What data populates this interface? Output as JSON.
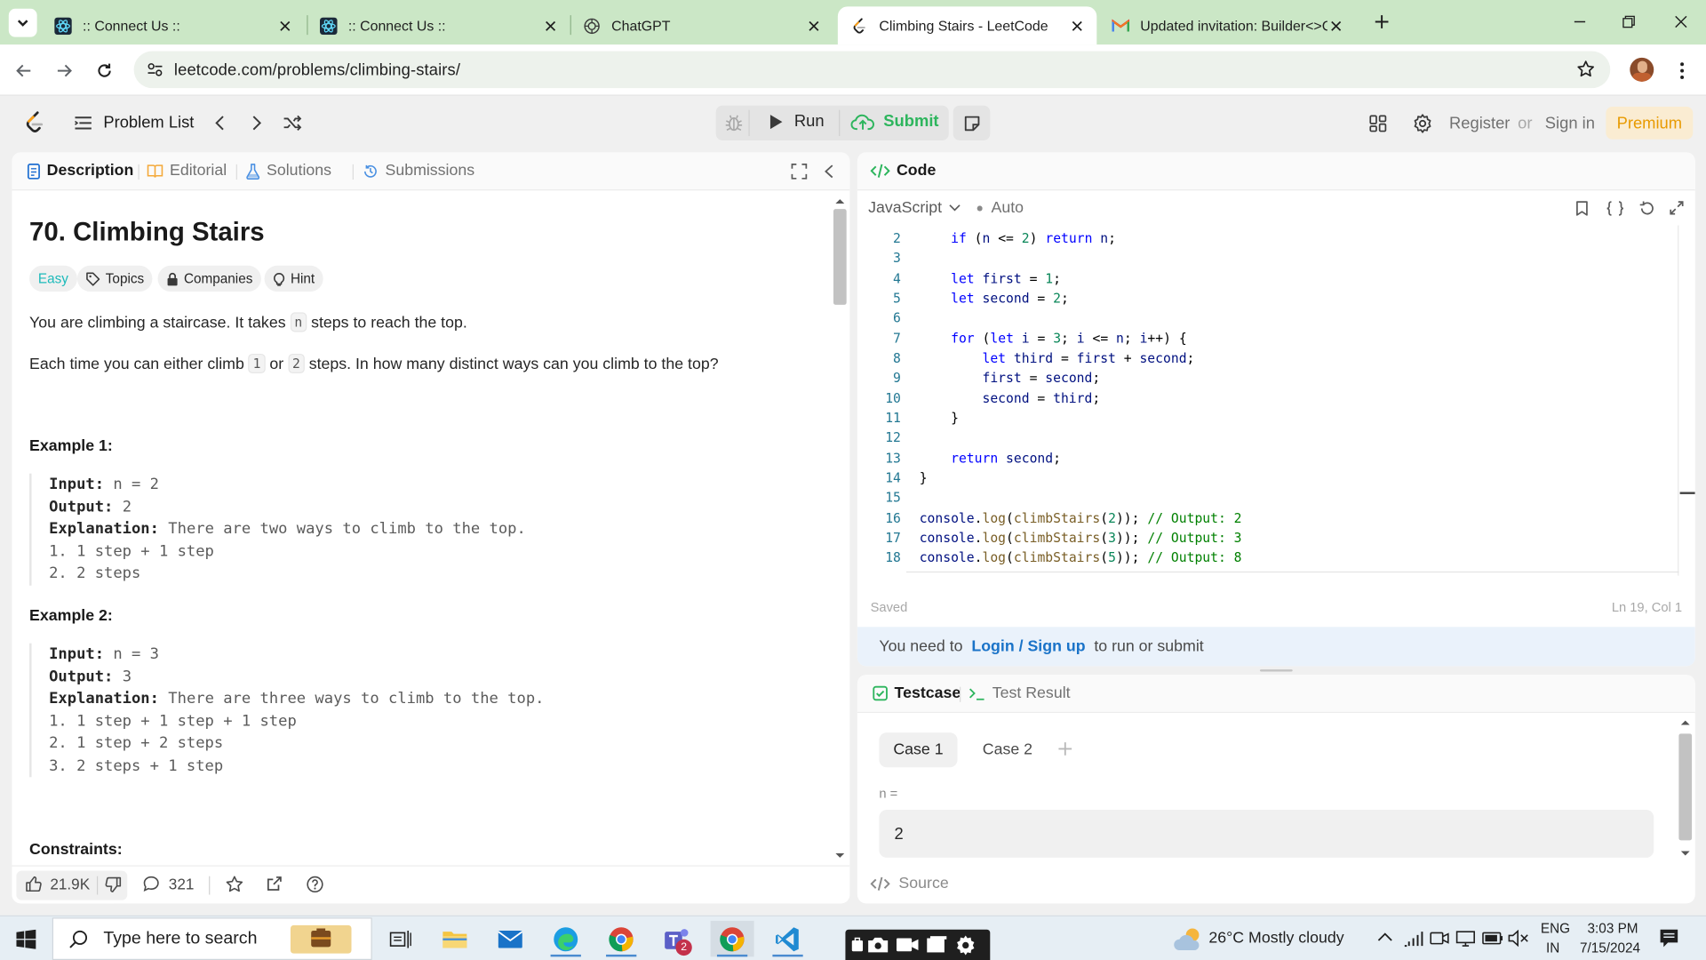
{
  "browser": {
    "tabs": [
      {
        "title": ":: Connect Us ::",
        "icon": "react-icon",
        "active": false
      },
      {
        "title": ":: Connect Us ::",
        "icon": "react-icon",
        "active": false
      },
      {
        "title": "ChatGPT",
        "icon": "chatgpt-icon",
        "active": false
      },
      {
        "title": "Climbing Stairs - LeetCode",
        "icon": "leetcode-icon",
        "active": true
      },
      {
        "title": "Updated invitation: Builder<>C",
        "icon": "gmail-icon",
        "active": false
      }
    ],
    "url": "leetcode.com/problems/climbing-stairs/"
  },
  "header": {
    "problem_list": "Problem List",
    "run": "Run",
    "submit": "Submit",
    "register": "Register",
    "or": "or",
    "sign_in": "Sign in",
    "premium": "Premium"
  },
  "left_panel": {
    "tabs": [
      "Description",
      "Editorial",
      "Solutions",
      "Submissions"
    ],
    "title": "70. Climbing Stairs",
    "chips": [
      "Easy",
      "Topics",
      "Companies",
      "Hint"
    ],
    "para1_pre": "You are climbing a staircase. It takes",
    "para1_code": "n",
    "para1_post": "steps to reach the top.",
    "para2_pre": "Each time you can either climb",
    "para2_code1": "1",
    "para2_mid": "or",
    "para2_code2": "2",
    "para2_post": "steps. In how many distinct ways can you climb to the top?",
    "examples": [
      {
        "heading": "Example 1:",
        "input_label": "Input:",
        "input": "n = 2",
        "output_label": "Output:",
        "output": "2",
        "expl_label": "Explanation:",
        "explanation": "There are two ways to climb to the top.",
        "steps": [
          "1. 1 step + 1 step",
          "2. 2 steps"
        ]
      },
      {
        "heading": "Example 2:",
        "input_label": "Input:",
        "input": "n = 3",
        "output_label": "Output:",
        "output": "3",
        "expl_label": "Explanation:",
        "explanation": "There are three ways to climb to the top.",
        "steps": [
          "1. 1 step + 1 step + 1 step",
          "2. 1 step + 2 steps",
          "3. 2 steps + 1 step"
        ]
      }
    ],
    "constraints": "Constraints:",
    "footer": {
      "likes": "21.9K",
      "comments": "321"
    }
  },
  "code_panel": {
    "title": "Code",
    "language": "JavaScript",
    "mode": "Auto",
    "lines": [
      {
        "n": "2",
        "code": "    if (n <= 2) return n;"
      },
      {
        "n": "3",
        "code": ""
      },
      {
        "n": "4",
        "code": "    let first = 1;"
      },
      {
        "n": "5",
        "code": "    let second = 2;"
      },
      {
        "n": "6",
        "code": ""
      },
      {
        "n": "7",
        "code": "    for (let i = 3; i <= n; i++) {"
      },
      {
        "n": "8",
        "code": "        let third = first + second;"
      },
      {
        "n": "9",
        "code": "        first = second;"
      },
      {
        "n": "10",
        "code": "        second = third;"
      },
      {
        "n": "11",
        "code": "    }"
      },
      {
        "n": "12",
        "code": ""
      },
      {
        "n": "13",
        "code": "    return second;"
      },
      {
        "n": "14",
        "code": "}"
      },
      {
        "n": "15",
        "code": ""
      },
      {
        "n": "16",
        "code": "console.log(climbStairs(2)); // Output: 2"
      },
      {
        "n": "17",
        "code": "console.log(climbStairs(3)); // Output: 3"
      },
      {
        "n": "18",
        "code": "console.log(climbStairs(5)); // Output: 8"
      }
    ],
    "status": "Saved",
    "cursor": "Ln 19, Col 1",
    "login_prefix": "You need to",
    "login_link": "Login / Sign up",
    "login_suffix": "to run or submit"
  },
  "test_panel": {
    "tabs": [
      "Testcase",
      "Test Result"
    ],
    "cases": [
      "Case 1",
      "Case 2"
    ],
    "param_label": "n =",
    "param_value": "2",
    "source": "Source"
  },
  "taskbar": {
    "search_placeholder": "Type here to search",
    "weather": "26°C  Mostly cloudy",
    "lang": "ENG",
    "region": "IN",
    "time": "3:03 PM",
    "date": "7/15/2024",
    "teams_badge": "2"
  }
}
